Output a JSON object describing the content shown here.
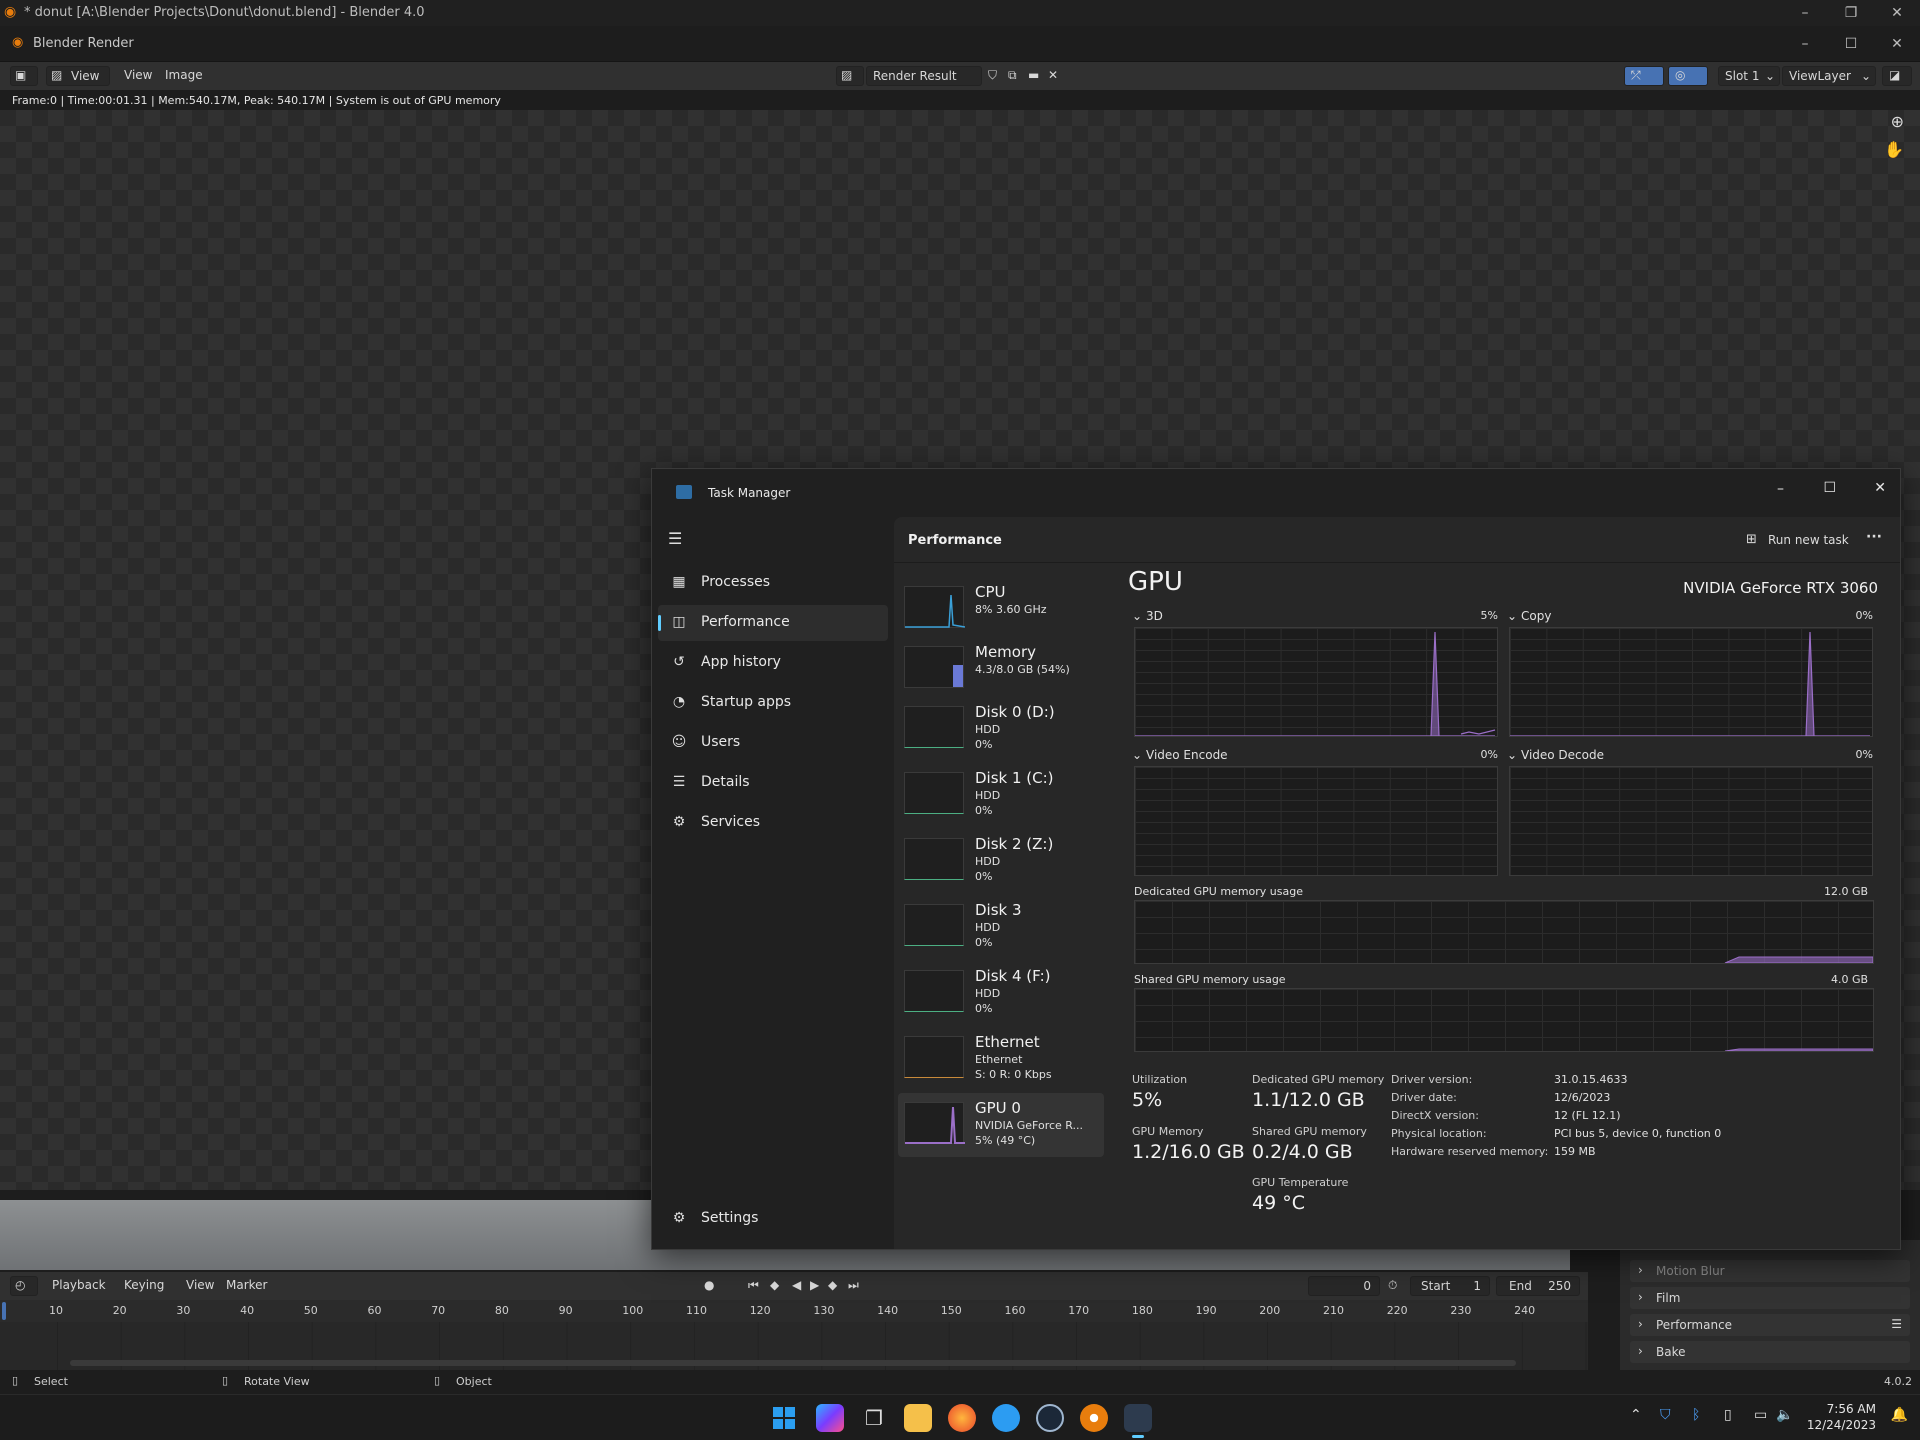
{
  "blender": {
    "window_title": "* donut [A:\\Blender Projects\\Donut\\donut.blend] - Blender 4.0",
    "render_window_title": "Blender Render",
    "header": {
      "view": "View",
      "view2": "View",
      "image": "Image",
      "render_result": "Render Result",
      "slot": "Slot 1",
      "view_layer": "ViewLayer"
    },
    "status_line": "Frame:0 | Time:00:01.31 | Mem:540.17M, Peak: 540.17M | System is out of GPU memory",
    "timeline": {
      "playback": "Playback",
      "keying": "Keying",
      "view": "View",
      "marker": "Marker",
      "current_frame": "0",
      "start_label": "Start",
      "start_value": "1",
      "end_label": "End",
      "end_value": "250",
      "ticks": [
        "10",
        "20",
        "30",
        "40",
        "50",
        "60",
        "70",
        "80",
        "90",
        "100",
        "110",
        "120",
        "130",
        "140",
        "150",
        "160",
        "170",
        "180",
        "190",
        "200",
        "210",
        "220",
        "230",
        "240"
      ]
    },
    "properties": [
      "Motion Blur",
      "Film",
      "Performance",
      "Bake"
    ],
    "statusbar": {
      "select": "Select",
      "rotate_view": "Rotate View",
      "object": "Object",
      "version": "4.0.2"
    }
  },
  "taskbar": {
    "time": "7:56 AM",
    "date": "12/24/2023"
  },
  "task_manager": {
    "title": "Task Manager",
    "nav": [
      {
        "label": "Processes",
        "icon": "processes-icon"
      },
      {
        "label": "Performance",
        "icon": "performance-icon"
      },
      {
        "label": "App history",
        "icon": "history-icon"
      },
      {
        "label": "Startup apps",
        "icon": "startup-icon"
      },
      {
        "label": "Users",
        "icon": "users-icon"
      },
      {
        "label": "Details",
        "icon": "details-icon"
      },
      {
        "label": "Services",
        "icon": "services-icon"
      }
    ],
    "settings": "Settings",
    "section_title": "Performance",
    "run_new_task": "Run new task",
    "resources": [
      {
        "name": "CPU",
        "line1": "8% 3.60 GHz",
        "line2": ""
      },
      {
        "name": "Memory",
        "line1": "4.3/8.0 GB (54%)",
        "line2": ""
      },
      {
        "name": "Disk 0 (D:)",
        "line1": "HDD",
        "line2": "0%"
      },
      {
        "name": "Disk 1 (C:)",
        "line1": "HDD",
        "line2": "0%"
      },
      {
        "name": "Disk 2 (Z:)",
        "line1": "HDD",
        "line2": "0%"
      },
      {
        "name": "Disk 3",
        "line1": "HDD",
        "line2": "0%"
      },
      {
        "name": "Disk 4 (F:)",
        "line1": "HDD",
        "line2": "0%"
      },
      {
        "name": "Ethernet",
        "line1": "Ethernet",
        "line2": "S: 0 R: 0 Kbps"
      },
      {
        "name": "GPU 0",
        "line1": "NVIDIA GeForce R...",
        "line2": "5% (49 °C)"
      }
    ],
    "gpu": {
      "heading": "GPU",
      "model": "NVIDIA GeForce RTX 3060",
      "engines": [
        {
          "name": "3D",
          "value": "5%"
        },
        {
          "name": "Copy",
          "value": "0%"
        },
        {
          "name": "Video Encode",
          "value": "0%"
        },
        {
          "name": "Video Decode",
          "value": "0%"
        }
      ],
      "dedicated_label": "Dedicated GPU memory usage",
      "dedicated_max": "12.0 GB",
      "shared_label": "Shared GPU memory usage",
      "shared_max": "4.0 GB",
      "stats": {
        "utilization_label": "Utilization",
        "utilization": "5%",
        "dedicated_mem_label": "Dedicated GPU memory",
        "dedicated_mem": "1.1/12.0 GB",
        "gpu_mem_label": "GPU Memory",
        "gpu_mem": "1.2/16.0 GB",
        "shared_mem_label": "Shared GPU memory",
        "shared_mem": "0.2/4.0 GB",
        "temp_label": "GPU Temperature",
        "temp": "49 °C"
      },
      "details": [
        {
          "label": "Driver version:",
          "value": "31.0.15.4633"
        },
        {
          "label": "Driver date:",
          "value": "12/6/2023"
        },
        {
          "label": "DirectX version:",
          "value": "12 (FL 12.1)"
        },
        {
          "label": "Physical location:",
          "value": "PCI bus 5, device 0, function 0"
        },
        {
          "label": "Hardware reserved memory:",
          "value": "159 MB"
        }
      ]
    }
  },
  "colors": {
    "accent": "#60cdff",
    "gpu_graph": "#9b6fc8",
    "cpu_graph": "#3aa0d8",
    "memory_graph": "#6a79d6"
  }
}
